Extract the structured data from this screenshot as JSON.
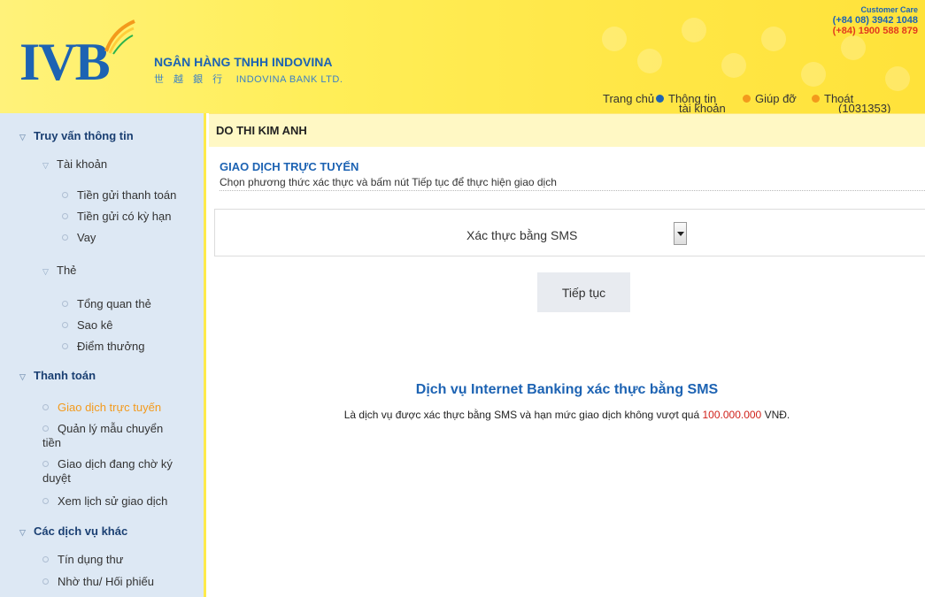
{
  "header": {
    "logo_text": "IVB",
    "bank_name": "NGÂN HÀNG TNHH INDOVINA",
    "bank_name_cjk": "世 越 銀 行",
    "bank_name_en": "INDOVINA BANK LTD.",
    "customer_care": {
      "title": "Customer Care",
      "phone1": "(+84 08) 3942 1048",
      "phone2": "(+84) 1900 588 879"
    },
    "nav": {
      "home": "Trang chủ",
      "account_info_line1": "Thông tin",
      "account_info_line2": "tài khoản",
      "help": "Giúp đỡ",
      "logout": "Thoát",
      "user_id": "(1031353)"
    }
  },
  "sidebar": {
    "sec1": "Truy vấn thông tin",
    "sub_account": "Tài khoản",
    "current_deposit": "Tiền gửi thanh toán",
    "term_deposit": "Tiền gửi có kỳ hạn",
    "loan": "Vay",
    "sub_card": "Thẻ",
    "card_overview": "Tổng quan thẻ",
    "statement": "Sao kê",
    "reward_points": "Điểm thưởng",
    "sec2": "Thanh toán",
    "online_tx": "Giao dịch trực tuyến",
    "transfer_templates_1": "Quản lý mẫu chuyển",
    "transfer_templates_2": "tiền",
    "pending_tx_1": "Giao dịch đang chờ ký",
    "pending_tx_2": "duyệt",
    "tx_history": "Xem lịch sử giao dịch",
    "sec3": "Các dịch vụ khác",
    "letter_of_credit": "Tín dụng thư",
    "collection": "Nhờ thu/ Hối phiếu"
  },
  "main": {
    "customer_name": "DO THI KIM ANH",
    "section_title": "GIAO DỊCH TRỰC TUYẾN",
    "section_desc": "Chọn phương thức xác thực và bấm nút Tiếp tục để thực hiện giao dịch",
    "auth_method": "Xác thực bằng SMS",
    "continue_label": "Tiếp tục",
    "info_title": "Dịch vụ Internet Banking xác thực bằng SMS",
    "info_desc_prefix": "Là dịch vụ được xác thực bằng SMS và hạn mức giao dịch không vượt quá",
    "info_desc_limit": "100.000.000",
    "info_desc_suffix": "VNĐ."
  },
  "colors": {
    "brand_blue": "#1d63b3",
    "header_yellow": "#ffee58",
    "accent_orange": "#f39a1c",
    "limit_red": "#d0221b",
    "sidebar_bg": "#dde8f4"
  }
}
